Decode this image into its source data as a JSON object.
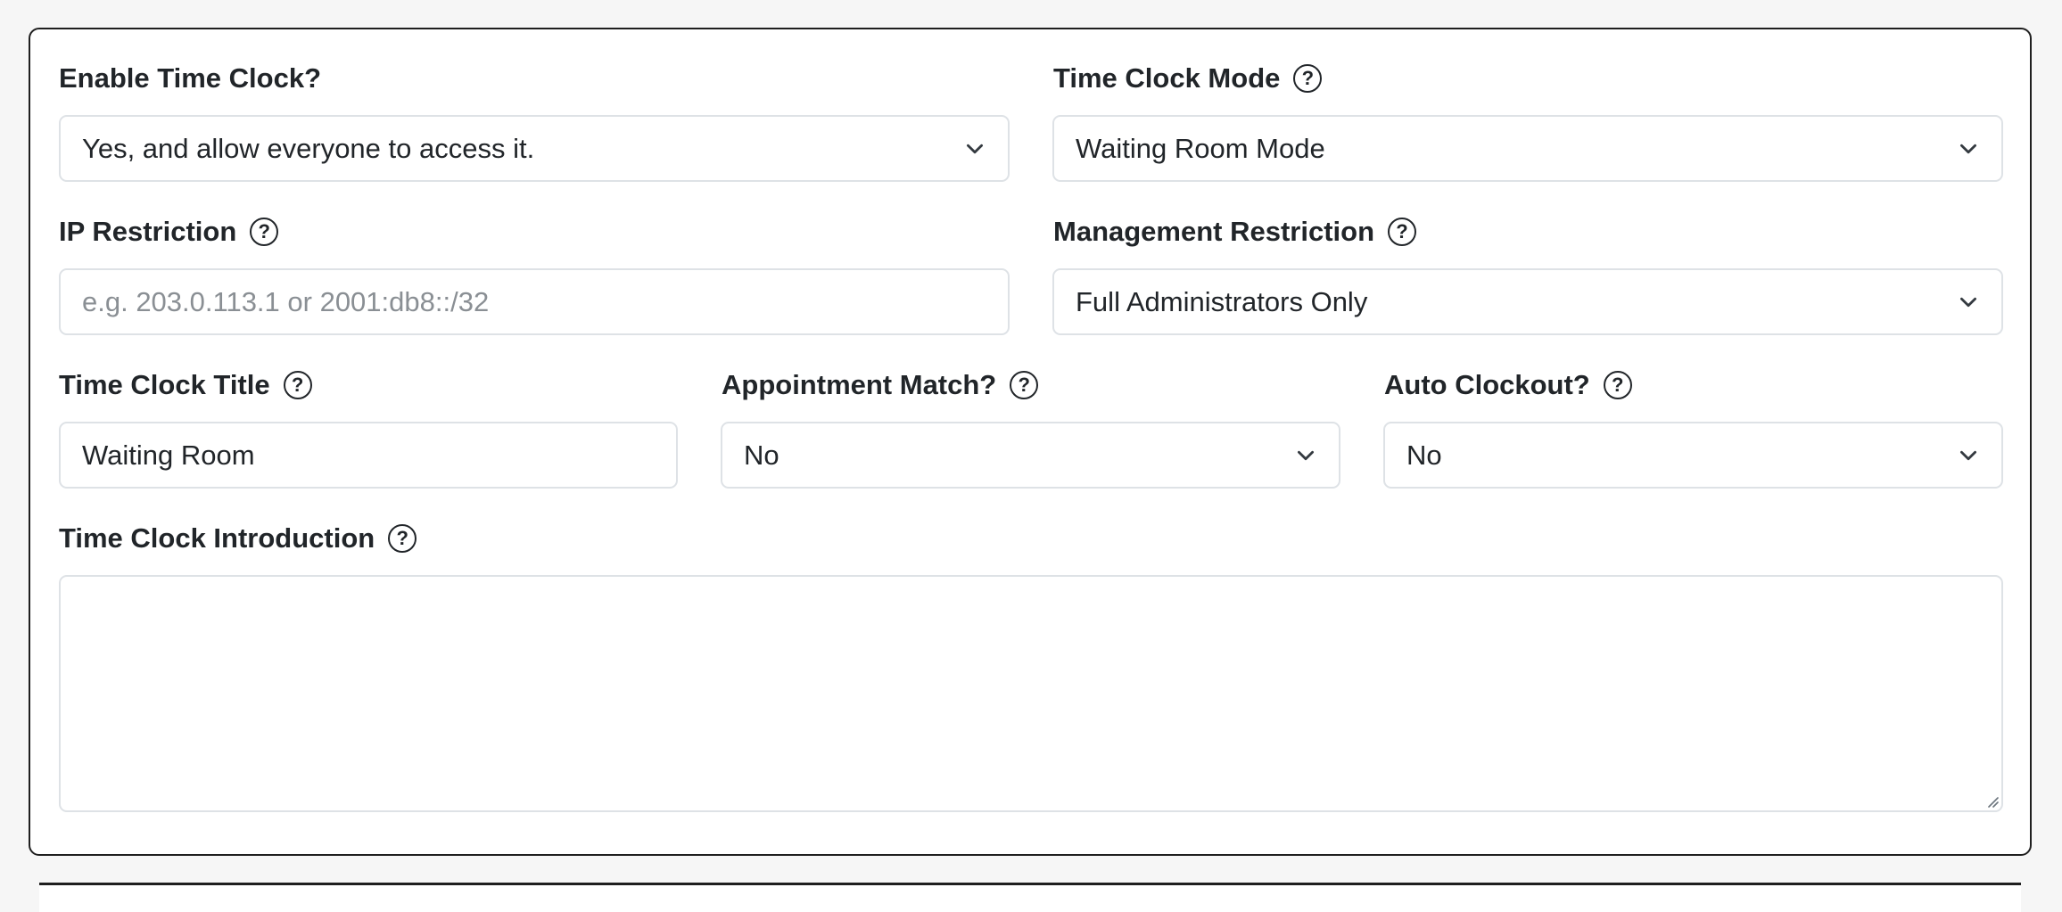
{
  "enable_time_clock": {
    "label": "Enable Time Clock?",
    "value": "Yes, and allow everyone to access it."
  },
  "time_clock_mode": {
    "label": "Time Clock Mode",
    "value": "Waiting Room Mode"
  },
  "ip_restriction": {
    "label": "IP Restriction",
    "value": "",
    "placeholder": "e.g. 203.0.113.1 or 2001:db8::/32"
  },
  "management_restriction": {
    "label": "Management Restriction",
    "value": "Full Administrators Only"
  },
  "time_clock_title": {
    "label": "Time Clock Title",
    "value": "Waiting Room"
  },
  "appointment_match": {
    "label": "Appointment Match?",
    "value": "No"
  },
  "auto_clockout": {
    "label": "Auto Clockout?",
    "value": "No"
  },
  "time_clock_introduction": {
    "label": "Time Clock Introduction",
    "value": ""
  },
  "help_glyph": "?",
  "colors": {
    "border": "#dee2e6",
    "panel_border": "#1f1f1f",
    "text": "#212529",
    "placeholder": "#8a8f94",
    "background": "#f6f6f6"
  },
  "icons": {
    "help": "question-circle-icon",
    "dropdown": "chevron-down-icon",
    "resize": "resize-handle-icon"
  }
}
